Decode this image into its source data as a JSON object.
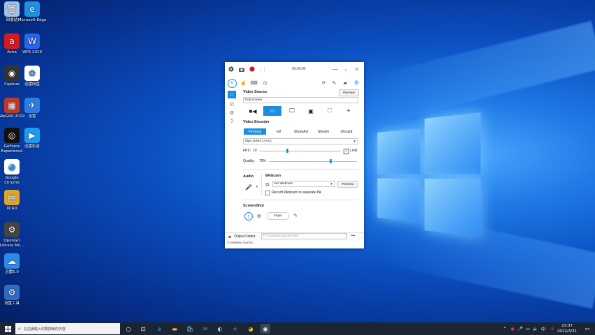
{
  "desktop_icons": [
    {
      "label": "回收站",
      "icon": "recycle-bin-icon",
      "color": "#9fc4e8",
      "glyph": "🗑"
    },
    {
      "label": "Microsoft Edge",
      "icon": "edge-icon",
      "color": "#1f8fe0",
      "glyph": "e"
    },
    {
      "label": "Avira",
      "icon": "avira-icon",
      "color": "#d71920",
      "glyph": "a"
    },
    {
      "label": "WPS 2019",
      "icon": "wps-icon",
      "color": "#2a64e8",
      "glyph": "W"
    },
    {
      "label": "Capture",
      "icon": "capture-icon",
      "color": "#333333",
      "glyph": "◉"
    },
    {
      "label": "迅雷网盘",
      "icon": "cloud-drive-icon",
      "color": "#ffffff",
      "glyph": "✿"
    },
    {
      "label": "WeGAD 2019",
      "icon": "cad-icon",
      "color": "#c0392b",
      "glyph": "▦"
    },
    {
      "label": "迅雷",
      "icon": "thunder-icon",
      "color": "#2c7de0",
      "glyph": "✈"
    },
    {
      "label": "GeForce Experience",
      "icon": "nvidia-icon",
      "color": "#111111",
      "glyph": "◎"
    },
    {
      "label": "迅雷影音",
      "icon": "video-player-icon",
      "color": "#1d9bf0",
      "glyph": "▶"
    },
    {
      "label": "Google Chrome",
      "icon": "chrome-icon",
      "color": "#ffffff",
      "glyph": "◕"
    },
    {
      "label": "XCAD",
      "icon": "xcad-icon",
      "color": "#e2a32b",
      "glyph": "▤"
    },
    {
      "label": "OpenGD Library Mo...",
      "icon": "library-icon",
      "color": "#444444",
      "glyph": "⚙"
    },
    {
      "label": "迅雷5.0",
      "icon": "cloud-icon",
      "color": "#2f8ae6",
      "glyph": "☁"
    },
    {
      "label": "设置工具",
      "icon": "settings-tool-icon",
      "color": "#2d6cc0",
      "glyph": "⚙"
    }
  ],
  "window": {
    "timer": "00:00:00",
    "video_source": {
      "title": "Video Source",
      "preview": "Preview",
      "field": "Full Screen"
    },
    "video_encoder": {
      "title": "Video Encoder",
      "tabs": [
        "FFmpeg",
        "Gif",
        "SharpAvi",
        "Stream",
        "Discard"
      ],
      "active_tab": "FFmpeg",
      "codec": "Mp4 (x264 | AAC)",
      "fps_label": "FPS:",
      "fps_value": "10",
      "limit_label": "Limit",
      "quality_label": "Quality:",
      "quality_value": "70%"
    },
    "audio": {
      "title": "Audio"
    },
    "webcam": {
      "title": "Webcam",
      "select": "No Webcam",
      "preview": "Preview",
      "separate": "Record Webcam to separate file"
    },
    "screenshot": {
      "title": "ScreenShot",
      "imgur": "Imgur"
    },
    "output": {
      "label": "Output Folder",
      "path": "F:\\CaptureOutputFolder",
      "more": "•••"
    },
    "footer": "© Mathew Sachin",
    "accent": "#1a8ee0"
  },
  "taskbar": {
    "search_placeholder": "在這裏輸入你要搜索的內容",
    "time": "23:37",
    "date": "2022/3/31",
    "ime": "中",
    "bg": "#1b2533"
  }
}
